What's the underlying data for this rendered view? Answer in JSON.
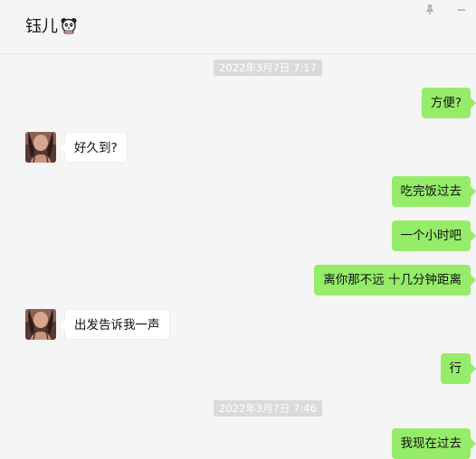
{
  "chat": {
    "title": "钰儿",
    "title_emoji_icon": "panda-icon"
  },
  "window_controls": {
    "pin_icon": "pin-icon",
    "minimize_icon": "minimize-icon"
  },
  "colors": {
    "outgoing_bubble": "#95ec69",
    "incoming_bubble": "#ffffff",
    "background": "#f5f5f5",
    "timestamp_bg": "#dadada"
  },
  "messages": [
    {
      "type": "timestamp",
      "text": "2022年3月7日 7:17"
    },
    {
      "type": "out",
      "text": "方便?"
    },
    {
      "type": "in",
      "text": "好久到?"
    },
    {
      "type": "out",
      "text": "吃完饭过去"
    },
    {
      "type": "out",
      "text": "一个小时吧"
    },
    {
      "type": "out",
      "text": "离你那不远 十几分钟距离"
    },
    {
      "type": "in",
      "text": "出发告诉我一声"
    },
    {
      "type": "out",
      "text": "行"
    },
    {
      "type": "timestamp",
      "text": "2022年3月7日 7:46"
    },
    {
      "type": "out",
      "text": "我现在过去"
    }
  ]
}
